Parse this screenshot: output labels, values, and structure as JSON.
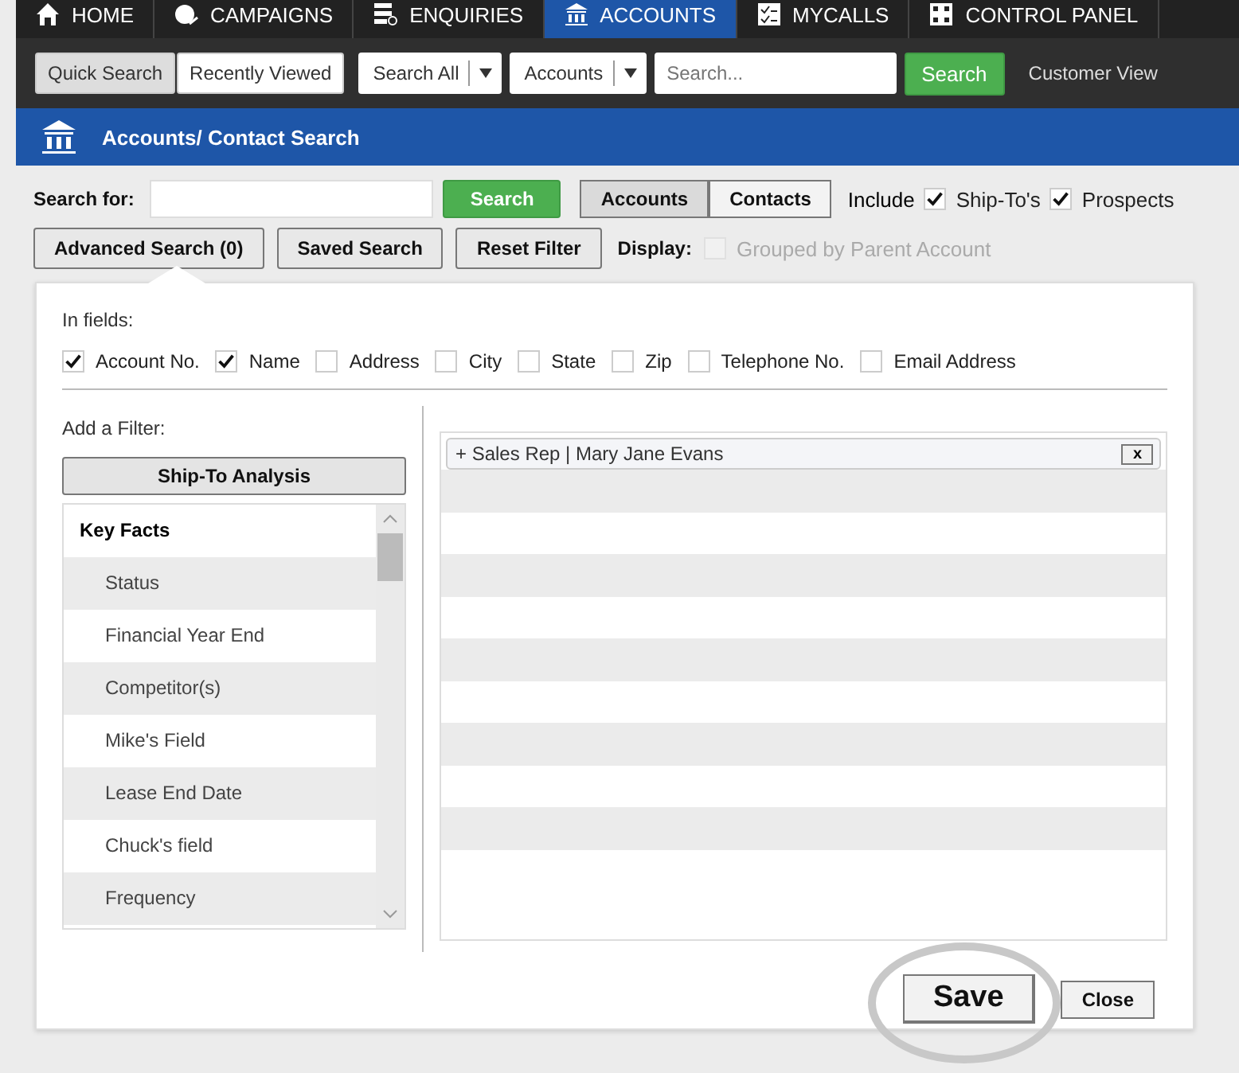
{
  "nav_tabs": [
    {
      "label": "HOME",
      "selected": false
    },
    {
      "label": "CAMPAIGNS",
      "selected": false
    },
    {
      "label": "ENQUIRIES",
      "selected": false
    },
    {
      "label": "ACCOUNTS",
      "selected": true
    },
    {
      "label": "MYCALLS",
      "selected": false
    },
    {
      "label": "CONTROL PANEL",
      "selected": false
    }
  ],
  "toolbar": {
    "view_toggle": [
      {
        "label": "Quick Search",
        "selected": true
      },
      {
        "label": "Recently Viewed",
        "selected": false
      }
    ],
    "dropdowns": [
      "Search All",
      "Accounts"
    ],
    "search": {
      "placeholder": "Search..."
    },
    "search_button": "Search",
    "link": "Customer View"
  },
  "page_title": "Accounts/ Contact Search",
  "search_row": {
    "label": "Search for:",
    "button": "Search",
    "scope": [
      {
        "label": "Accounts",
        "selected": true
      },
      {
        "label": "Contacts",
        "selected": false
      }
    ],
    "include_label": "Include",
    "include": [
      {
        "label": "Ship-To's",
        "checked": true
      },
      {
        "label": "Prospects",
        "checked": true
      }
    ]
  },
  "actions": [
    "Advanced Search (0)",
    "Saved Search",
    "Reset Filter"
  ],
  "display": {
    "label": "Display:",
    "option": {
      "label": "Grouped by Parent Account",
      "checked": false,
      "disabled": true
    }
  },
  "advanced": {
    "fields_label": "In fields:",
    "fields": [
      {
        "label": "Account No.",
        "checked": true
      },
      {
        "label": "Name",
        "checked": true
      },
      {
        "label": "Address",
        "checked": false
      },
      {
        "label": "City",
        "checked": false
      },
      {
        "label": "State",
        "checked": false
      },
      {
        "label": "Zip",
        "checked": false
      },
      {
        "label": "Telephone No.",
        "checked": false
      },
      {
        "label": "Email Address",
        "checked": false
      }
    ],
    "filter_label": "Add a Filter:",
    "filter_button": "Ship-To Analysis",
    "filter_list": [
      {
        "label": "Key Facts",
        "kind": "header"
      },
      {
        "label": "Status",
        "kind": "item"
      },
      {
        "label": "Financial Year End",
        "kind": "item"
      },
      {
        "label": "Competitor(s)",
        "kind": "item"
      },
      {
        "label": "Mike's Field",
        "kind": "item"
      },
      {
        "label": "Lease End Date",
        "kind": "item"
      },
      {
        "label": "Chuck's field",
        "kind": "item"
      },
      {
        "label": "Frequency",
        "kind": "item"
      }
    ],
    "active_filters": [
      {
        "label": "+ Sales Rep | Mary Jane Evans",
        "remove": "x"
      }
    ],
    "buttons": [
      {
        "label": "Save",
        "highlighted": true
      },
      {
        "label": "Close",
        "highlighted": false
      }
    ]
  }
}
